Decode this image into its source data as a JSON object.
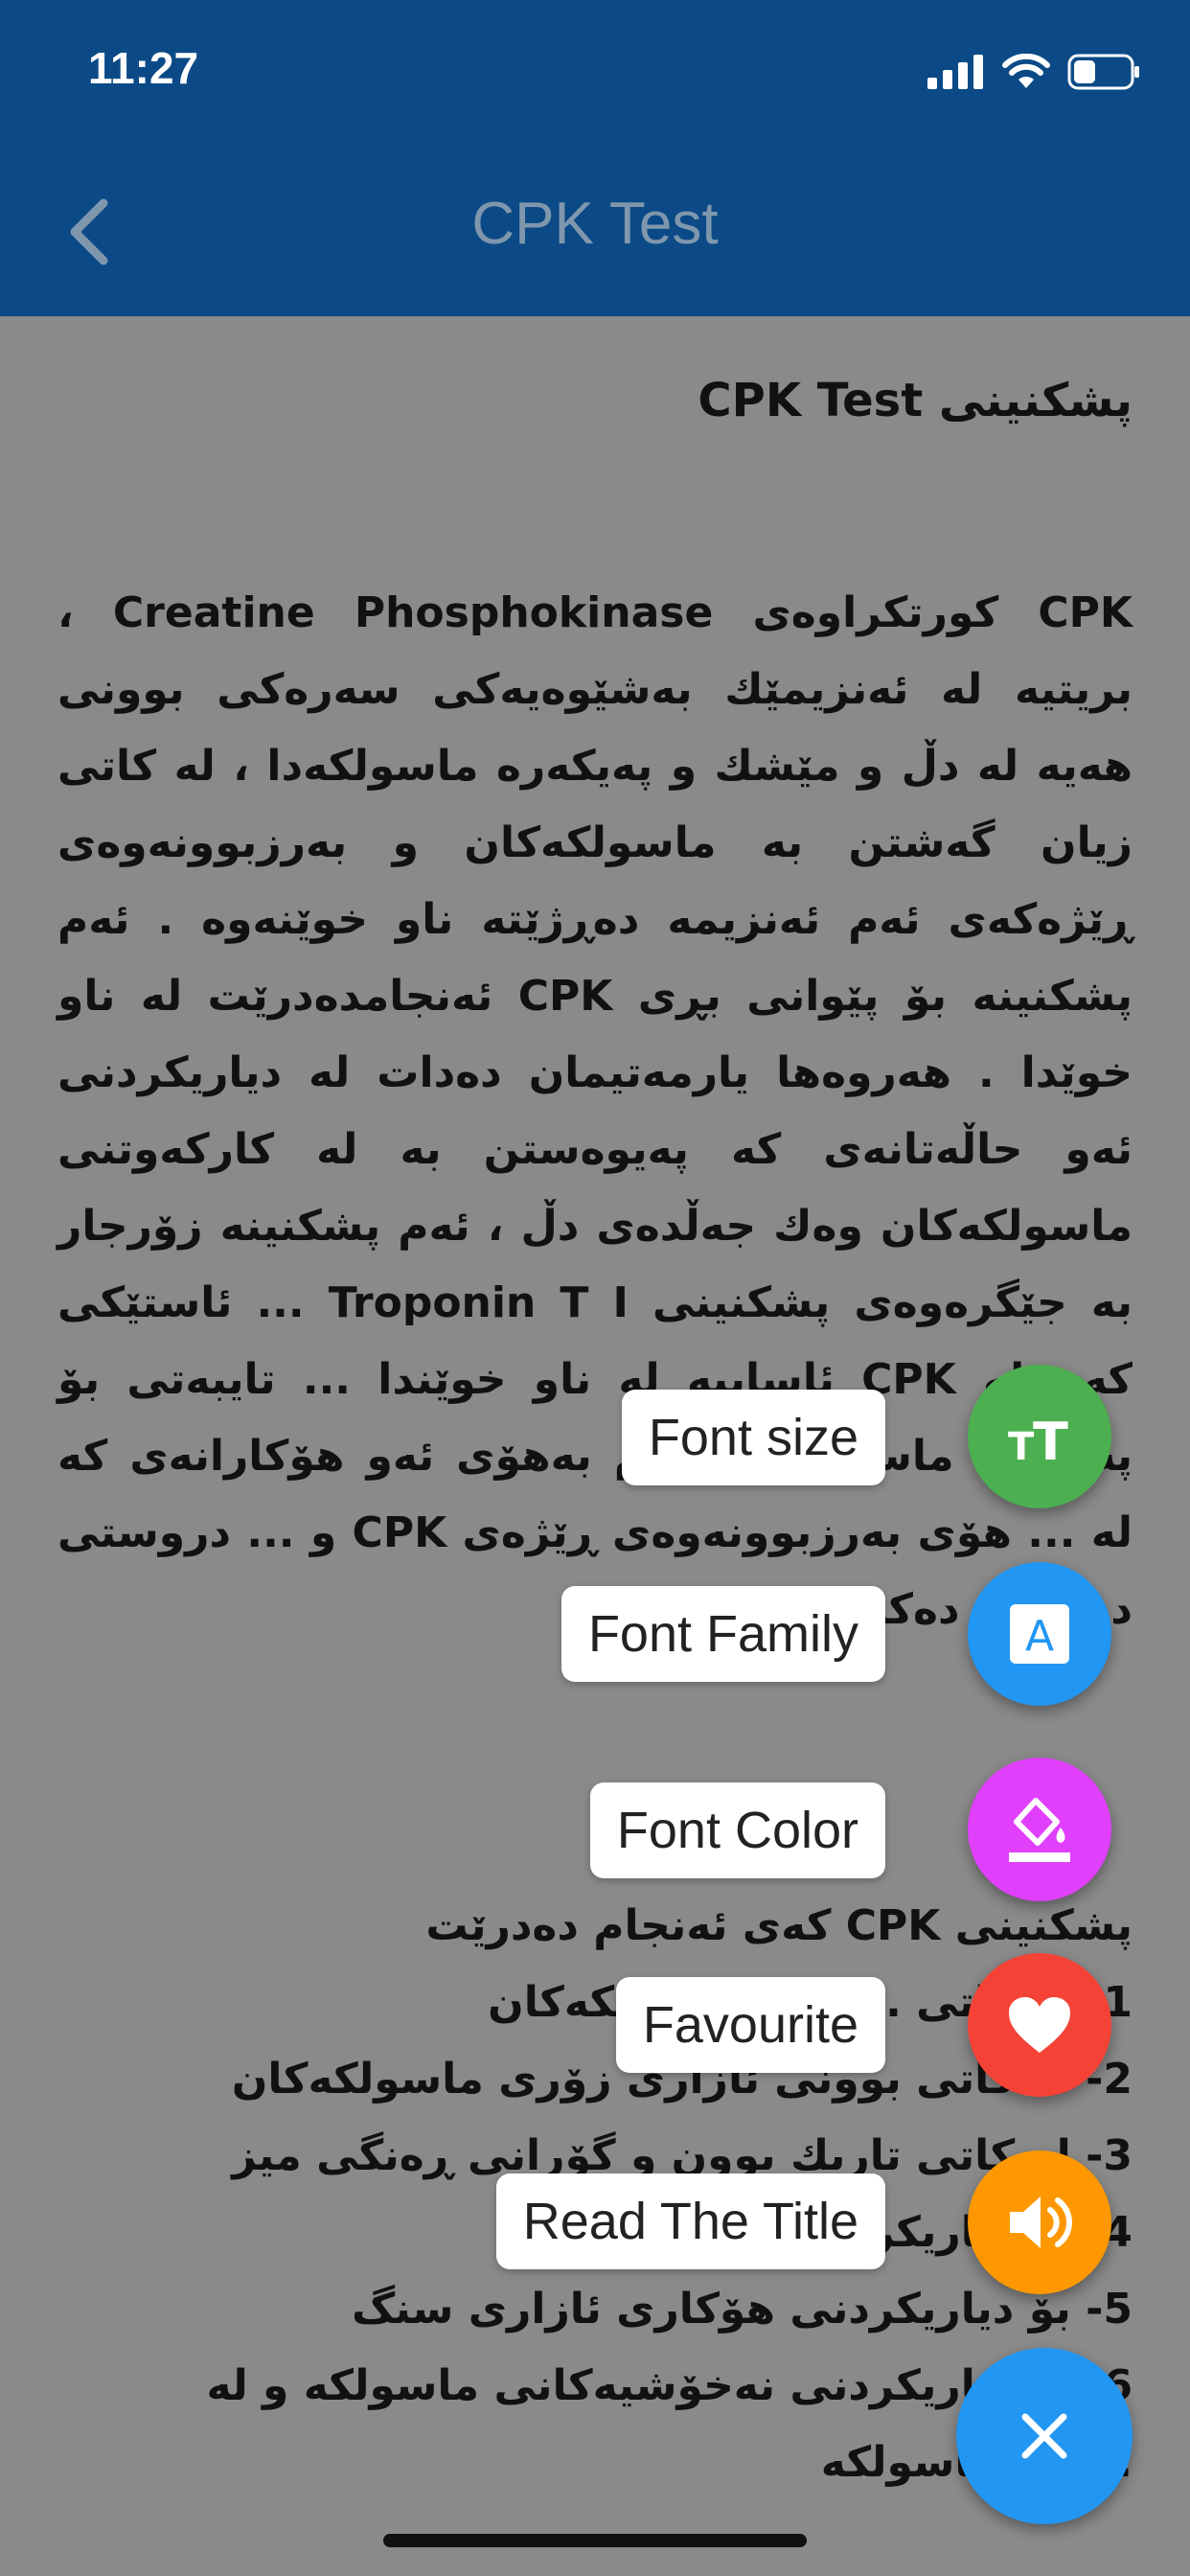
{
  "status_bar": {
    "time": "11:27"
  },
  "nav": {
    "title": "CPK Test",
    "back_icon": "chevron-left-icon"
  },
  "article": {
    "title": "پشکنینی CPK Test",
    "paragraph": "CPK کورتکراوەی Creatine Phosphokinase ، بریتیە لە ئەنزیمێك بەشێوەیەکی سەرەکی بوونی هەیە لە دڵ و مێشك و پەیکەرە ماسولکەدا ، لە کاتی زیان گەشتن بە ماسولکەکان و بەرزبوونەوەی ڕێژەکەی ئەم ئەنزیمە دەڕژێتە ناو خوێنەوە . ئەم پشکنینە بۆ پێوانی بڕی CPK ئەنجامدەدرێت لە ناو خوێدا . هەروەها یارمەتیمان دەدات لە دیاریکردنی ئەو حاڵەتانەی کە پەیوەستن بە لە کارکەوتنی ماسولکەکان وەك جەڵدەی دڵ ، ئەم پشکنینە زۆرجار بە جێگرەوەی پشکنینی Troponin T I ... ئاستێکی کەم لە CPK ئاساییە لە ناو خوێندا ... تایبەتی بۆ پەیکەرە ماسولکە . بەڵام بەهۆی ئەو هۆکارانەی کە لە ... هۆی بەرزبوونەوەی ڕێژەی CPK و ... دروستی دروست دەکەن .",
    "list_heading": "پشکنینی CPK کەی ئەنجام دەدرێت",
    "list_items": [
      "1- لە کاتی ... شی ماسولکەکان",
      "2- لە کاتی بوونی ئازاری زۆری ماسولکەکان",
      "3- لە کاتی تاریك بوون و گۆرانی ڕەنگی میز",
      "4- بۆ دیاریکردنی ...",
      "5- بۆ دیاریکردنی هۆکاری ئازاری سنگ",
      "6- بۆ دیاریکردنی نەخۆشیەکانی ماسولکە و لە",
      "... نی ماسولکە"
    ]
  },
  "fab_menu": {
    "items": [
      {
        "label": "Font size",
        "icon": "font-size-icon",
        "color": "#4caf50"
      },
      {
        "label": "Font Family",
        "icon": "font-family-icon",
        "color": "#2196f3"
      },
      {
        "label": "Font Color",
        "icon": "font-color-icon",
        "color": "#e040fb"
      },
      {
        "label": "Favourite",
        "icon": "heart-icon",
        "color": "#f44336"
      },
      {
        "label": "Read The Title",
        "icon": "speaker-icon",
        "color": "#ff9800"
      }
    ],
    "main": {
      "icon": "close-icon",
      "color": "#2196f3"
    }
  }
}
